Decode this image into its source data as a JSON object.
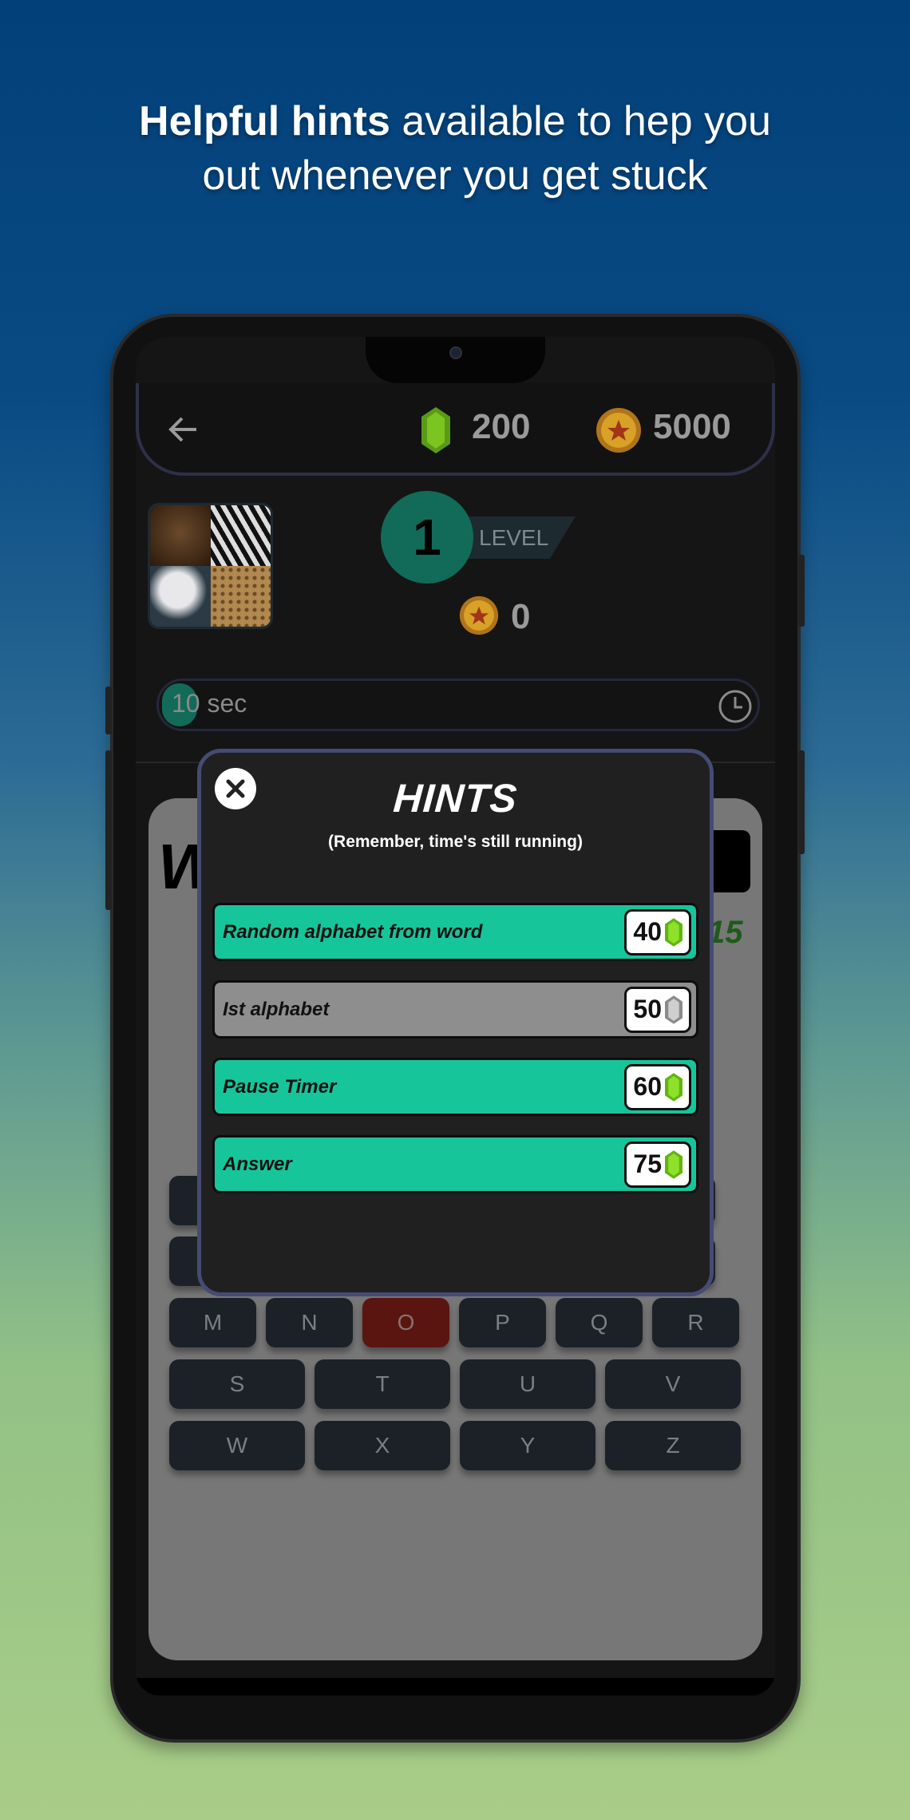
{
  "headline": {
    "bold": "Helpful hints",
    "rest_line1": " available to hep you",
    "line2": "out whenever you get stuck"
  },
  "colors": {
    "accent": "#17c59b",
    "level": "#126b58",
    "modal_border": "#464b73",
    "gem": "#7cc520",
    "gem_disabled": "#bdbdbd"
  },
  "header": {
    "back_icon": "arrow-left-icon",
    "gems": "200",
    "coins": "5000"
  },
  "level": {
    "number": "1",
    "label": "LEVEL",
    "level_coins": "0"
  },
  "timer": {
    "text": "10 sec",
    "icon": "clock-icon"
  },
  "hints": {
    "title": "HINTS",
    "subtitle": "(Remember, time's still running)",
    "items": [
      {
        "label": "Random alphabet from word",
        "price": "40",
        "enabled": true
      },
      {
        "label": "Ist alphabet",
        "price": "50",
        "enabled": false
      },
      {
        "label": "Pause Timer",
        "price": "60",
        "enabled": true
      },
      {
        "label": "Answer",
        "price": "75",
        "enabled": true
      }
    ]
  },
  "keyboard": {
    "row3": [
      "M",
      "N",
      "O",
      "P",
      "Q",
      "R"
    ],
    "row4": [
      "S",
      "T",
      "U",
      "V"
    ],
    "row5": [
      "W",
      "X",
      "Y",
      "Z"
    ],
    "highlighted": "O"
  },
  "card_peek": {
    "score": "15"
  }
}
